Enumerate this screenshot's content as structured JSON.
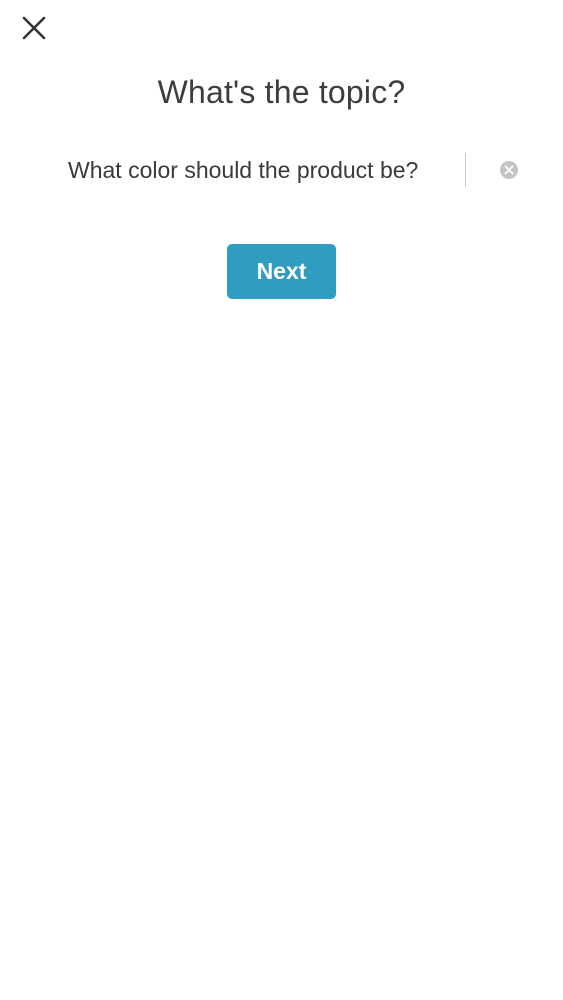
{
  "header": {
    "close_icon": "close-icon",
    "title": "What's the topic?"
  },
  "topic_input": {
    "value": "What color should the product be?",
    "placeholder": "",
    "clear_icon": "clear-circle-icon"
  },
  "actions": {
    "next_label": "Next"
  },
  "colors": {
    "accent": "#2f9cc0",
    "text": "#3d3d3d",
    "clear_icon": "#c4c4c4"
  }
}
